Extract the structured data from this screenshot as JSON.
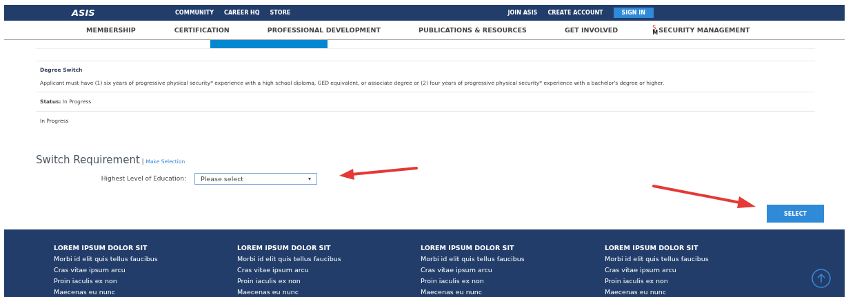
{
  "top_bar": {
    "logo": "ASIS",
    "links": [
      "COMMUNITY",
      "CAREER HQ",
      "STORE"
    ],
    "account_links": [
      "JOIN ASIS",
      "CREATE ACCOUNT"
    ],
    "sign_in": "SIGN IN"
  },
  "nav": {
    "items": [
      "MEMBERSHIP",
      "CERTIFICATION",
      "PROFESSIONAL DEVELOPMENT",
      "PUBLICATIONS & RESOURCES",
      "GET INVOLVED"
    ],
    "brand_letters": [
      "S",
      "M"
    ],
    "brand": "SECURITY MANAGEMENT"
  },
  "requirement": {
    "title": "Degree Switch",
    "description": "Applicant must have (1) six years of progressive physical security* experience with a high school diploma, GED equivalent, or associate degree or (2) four years of progressive physical security* experience with a bachelor's degree or higher.",
    "status": "**Status:** In Progress",
    "note": "In Progress"
  },
  "switch": {
    "heading": "Switch Requirement",
    "divider": "|",
    "link": "Make Selection",
    "field_label": "Highest Level of Education:",
    "select_value": "Please select",
    "select_caret": "▾",
    "button": "SELECT"
  },
  "footer": {
    "columns": [
      {
        "heading": "LOREM IPSUM DOLOR SIT",
        "links": [
          "Morbi id elit quis tellus faucibus",
          "Cras vitae ipsum arcu",
          "Proin iaculis ex non",
          "Maecenas eu nunc"
        ]
      },
      {
        "heading": "LOREM IPSUM DOLOR SIT",
        "links": [
          "Morbi id elit quis tellus faucibus",
          "Cras vitae ipsum arcu",
          "Proin iaculis ex non",
          "Maecenas eu nunc"
        ]
      },
      {
        "heading": "LOREM IPSUM DOLOR SIT",
        "links": [
          "Morbi id elit quis tellus faucibus",
          "Cras vitae ipsum arcu",
          "Proin iaculis ex non",
          "Maecenas eu nunc"
        ]
      },
      {
        "heading": "LOREM IPSUM DOLOR SIT",
        "links": [
          "Morbi id elit quis tellus faucibus",
          "Cras vitae ipsum arcu",
          "Proin iaculis ex non",
          "Maecenas eu nunc"
        ]
      }
    ]
  }
}
